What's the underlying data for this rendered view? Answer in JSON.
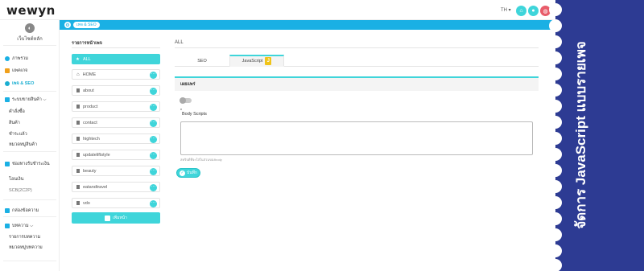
{
  "app": {
    "logo": "wewyn",
    "language": "TH ▾"
  },
  "sidebar": {
    "site_name": "เว็บไซต์หลัก",
    "items": [
      {
        "label": "ภาพรวม"
      },
      {
        "label": "แพคเกจ"
      },
      {
        "label": "เพจ & SEO"
      },
      {
        "label": "ระบบขายสินค้า ⌵"
      },
      {
        "label": "คำสั่งซื้อ"
      },
      {
        "label": "สินค้า"
      },
      {
        "label": "ชำระแล้ว"
      },
      {
        "label": "หมวดหมู่สินค้า"
      },
      {
        "label": "ช่องทางรับชำระเงิน"
      },
      {
        "label": "โอนเงิน"
      },
      {
        "label": "SCB(2C2P)"
      },
      {
        "label": "กล่องข้อความ"
      },
      {
        "label": "บทความ ⌵"
      },
      {
        "label": "รายการบทความ"
      },
      {
        "label": "หมวดหมู่บทความ"
      }
    ]
  },
  "breadcrumb": {
    "current": "เพจ & SEO"
  },
  "page_list": {
    "title": "รายการหน้าเพจ",
    "all_label": "ALL",
    "pages": [
      "HOME",
      "about",
      "product",
      "contact",
      "hightech",
      "updateliftstyle",
      "beauty",
      "eatandtravel",
      "vdo"
    ],
    "add_label": "เพิ่มหน้า"
  },
  "editor": {
    "selected_page": "ALL",
    "tabs": [
      {
        "label": "SEO"
      },
      {
        "label": "JavaScript"
      }
    ],
    "section_title": "เผยแพร่",
    "required_mark": "*",
    "field_label": "Body Scripts",
    "hint": "สคริปต์ที่จะใส่ในส่วนของbody",
    "save_label": "บันทึก"
  },
  "banner": {
    "text": "จัดการ JavaScript แบบรายเพจ"
  },
  "colors": {
    "brand_blue": "#1ab0e4",
    "accent_teal": "#3fd5da",
    "banner_navy": "#2d3b93"
  }
}
